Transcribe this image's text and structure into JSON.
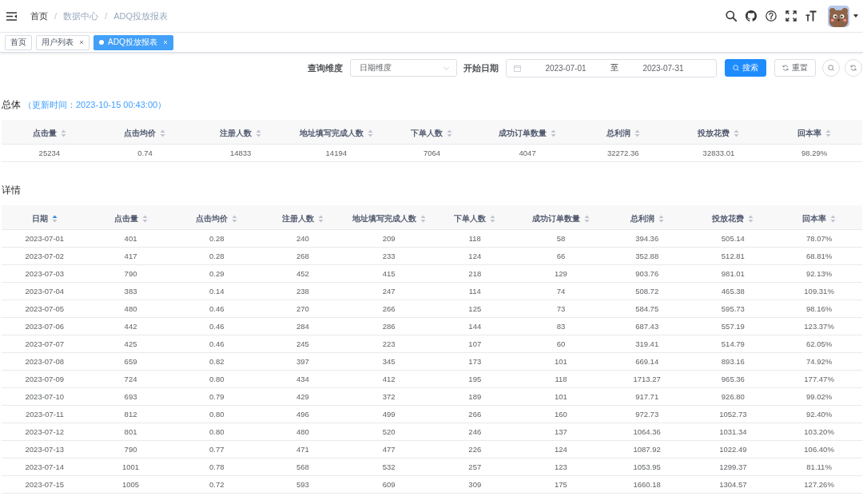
{
  "navbar": {
    "breadcrumb": {
      "items": [
        {
          "label": "首页",
          "link": true
        },
        {
          "label": "数据中心",
          "link": false
        },
        {
          "label": "ADQ投放报表",
          "link": false
        }
      ],
      "separators": [
        "/",
        "/"
      ]
    }
  },
  "tabs": [
    {
      "label": "首页",
      "selected": false,
      "closable": false
    },
    {
      "label": "用户列表",
      "selected": false,
      "closable": true
    },
    {
      "label": "ADQ投放报表",
      "selected": true,
      "closable": true
    }
  ],
  "filters": {
    "dimension": {
      "label": "查询维度",
      "value": "日期维度"
    },
    "date_range": {
      "label": "开始日期",
      "start": "2023-07-01",
      "separator": "至",
      "end": "2023-07-31"
    },
    "buttons": [
      {
        "label": "搜索",
        "kind": "primary"
      },
      {
        "label": "重置",
        "kind": "default"
      }
    ]
  },
  "summary": {
    "title": "总体",
    "updated": "（更新时间：2023-10-15 00:43:00）",
    "columns": [
      {
        "label": "点击量",
        "sorted_ascending": false
      },
      {
        "label": "点击均价",
        "sorted_ascending": false
      },
      {
        "label": "注册人数",
        "sorted_ascending": false
      },
      {
        "label": "地址填写完成人数",
        "sorted_ascending": false
      },
      {
        "label": "下单人数",
        "sorted_ascending": false
      },
      {
        "label": "成功订单数量",
        "sorted_ascending": false
      },
      {
        "label": "总利润",
        "sorted_ascending": false
      },
      {
        "label": "投放花费",
        "sorted_ascending": false
      },
      {
        "label": "回本率",
        "sorted_ascending": false
      }
    ],
    "rows": [
      [
        "25234",
        "0.74",
        "14833",
        "14194",
        "7064",
        "4047",
        "32272.36",
        "32833.01",
        "98.29%"
      ]
    ]
  },
  "detail": {
    "title": "详情",
    "columns": [
      {
        "label": "日期",
        "sorted_ascending": true
      },
      {
        "label": "点击量",
        "sorted_ascending": false
      },
      {
        "label": "点击均价",
        "sorted_ascending": false
      },
      {
        "label": "注册人数",
        "sorted_ascending": false
      },
      {
        "label": "地址填写完成人数",
        "sorted_ascending": false
      },
      {
        "label": "下单人数",
        "sorted_ascending": false
      },
      {
        "label": "成功订单数量",
        "sorted_ascending": false
      },
      {
        "label": "总利润",
        "sorted_ascending": false
      },
      {
        "label": "投放花费",
        "sorted_ascending": false
      },
      {
        "label": "回本率",
        "sorted_ascending": false
      }
    ],
    "rows": [
      [
        "2023-07-01",
        "401",
        "0.28",
        "240",
        "209",
        "118",
        "58",
        "394.36",
        "505.14",
        "78.07%"
      ],
      [
        "2023-07-02",
        "417",
        "0.28",
        "268",
        "233",
        "124",
        "66",
        "352.88",
        "512.81",
        "68.81%"
      ],
      [
        "2023-07-03",
        "790",
        "0.29",
        "452",
        "415",
        "218",
        "129",
        "903.76",
        "981.01",
        "92.13%"
      ],
      [
        "2023-07-04",
        "383",
        "0.14",
        "238",
        "247",
        "114",
        "74",
        "508.72",
        "465.38",
        "109.31%"
      ],
      [
        "2023-07-05",
        "480",
        "0.46",
        "270",
        "266",
        "125",
        "73",
        "584.75",
        "595.73",
        "98.16%"
      ],
      [
        "2023-07-06",
        "442",
        "0.46",
        "284",
        "286",
        "144",
        "83",
        "687.43",
        "557.19",
        "123.37%"
      ],
      [
        "2023-07-07",
        "425",
        "0.46",
        "245",
        "223",
        "107",
        "60",
        "319.41",
        "514.79",
        "62.05%"
      ],
      [
        "2023-07-08",
        "659",
        "0.82",
        "397",
        "345",
        "173",
        "101",
        "669.14",
        "893.16",
        "74.92%"
      ],
      [
        "2023-07-09",
        "724",
        "0.80",
        "434",
        "412",
        "195",
        "118",
        "1713.27",
        "965.36",
        "177.47%"
      ],
      [
        "2023-07-10",
        "693",
        "0.79",
        "429",
        "372",
        "189",
        "101",
        "917.71",
        "926.80",
        "99.02%"
      ],
      [
        "2023-07-11",
        "812",
        "0.80",
        "496",
        "499",
        "266",
        "160",
        "972.73",
        "1052.73",
        "92.40%"
      ],
      [
        "2023-07-12",
        "801",
        "0.80",
        "480",
        "520",
        "246",
        "137",
        "1064.36",
        "1031.34",
        "103.20%"
      ],
      [
        "2023-07-13",
        "790",
        "0.77",
        "471",
        "477",
        "226",
        "124",
        "1087.92",
        "1022.49",
        "106.40%"
      ],
      [
        "2023-07-14",
        "1001",
        "0.78",
        "568",
        "532",
        "257",
        "123",
        "1053.95",
        "1299.37",
        "81.11%"
      ],
      [
        "2023-07-15",
        "1005",
        "0.72",
        "593",
        "609",
        "309",
        "175",
        "1660.18",
        "1304.57",
        "127.26%"
      ]
    ]
  }
}
